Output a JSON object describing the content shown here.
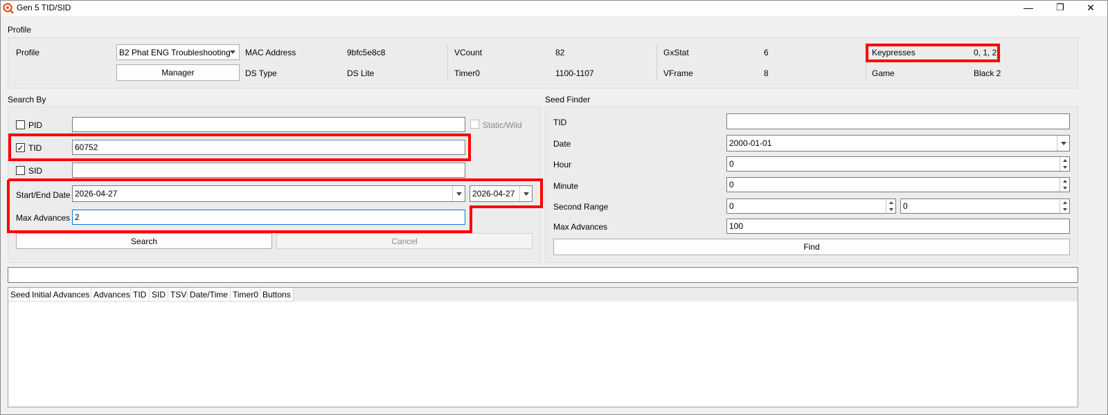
{
  "window": {
    "title": "Gen 5 TID/SID",
    "minimize": "—",
    "restore": "❐",
    "close": "✕"
  },
  "profile": {
    "group_title": "Profile",
    "profile_label": "Profile",
    "profile_value": "B2 Phat ENG Troubleshooting",
    "manager_button": "Manager",
    "mac_label": "MAC Address",
    "mac_value": "9bfc5e8c8",
    "dstype_label": "DS Type",
    "dstype_value": "DS Lite",
    "vcount_label": "VCount",
    "vcount_value": "82",
    "timer0_label": "Timer0",
    "timer0_value": "1100-1107",
    "gxstat_label": "GxStat",
    "gxstat_value": "6",
    "vframe_label": "VFrame",
    "vframe_value": "8",
    "keypresses_label": "Keypresses",
    "keypresses_value": "0, 1, 2",
    "game_label": "Game",
    "game_value": "Black 2"
  },
  "search_by": {
    "group_title": "Search By",
    "pid_label": "PID",
    "pid_checked": false,
    "pid_value": "",
    "static_wild_label": "Static/Wild",
    "tid_label": "TID",
    "tid_checked": true,
    "tid_value": "60752",
    "sid_label": "SID",
    "sid_checked": false,
    "sid_value": "",
    "date_label": "Start/End Date",
    "start_date": "2026-04-27",
    "end_date": "2026-04-27",
    "max_adv_label": "Max Advances",
    "max_adv_value": "2",
    "search_button": "Search",
    "cancel_button": "Cancel"
  },
  "seed_finder": {
    "group_title": "Seed Finder",
    "tid_label": "TID",
    "tid_value": "",
    "date_label": "Date",
    "date_value": "2000-01-01",
    "hour_label": "Hour",
    "hour_value": "0",
    "minute_label": "Minute",
    "minute_value": "0",
    "second_label": "Second Range",
    "second_from": "0",
    "second_to": "0",
    "max_adv_label": "Max Advances",
    "max_adv_value": "100",
    "find_button": "Find"
  },
  "filter_bar": {
    "value": ""
  },
  "results_table": {
    "columns": [
      "Seed",
      "Initial Advances",
      "Advances",
      "TID",
      "SID",
      "TSV",
      "Date/Time",
      "Timer0",
      "Buttons"
    ]
  },
  "colors": {
    "highlight": "#ff0000",
    "focus": "#0078d7"
  }
}
